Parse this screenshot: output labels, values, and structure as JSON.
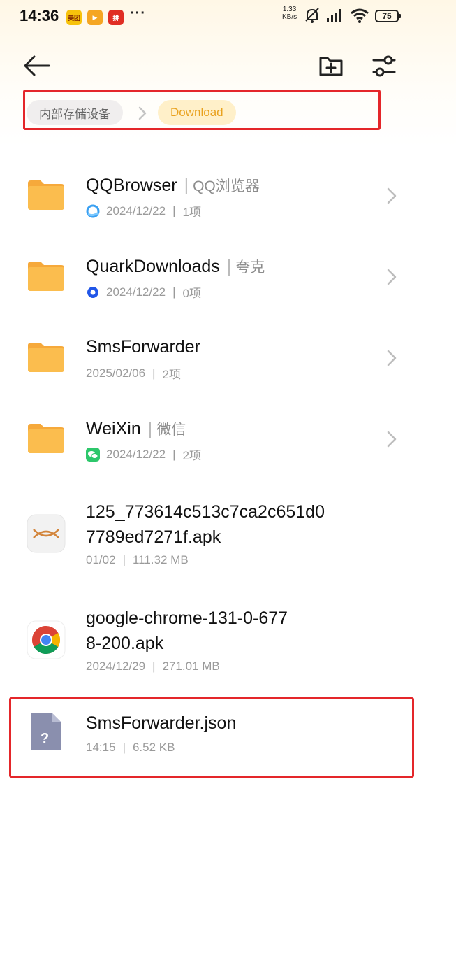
{
  "status_bar": {
    "time": "14:36",
    "app_icons": [
      {
        "name": "meituan",
        "label": "美团",
        "color": "#f7c20b"
      },
      {
        "name": "video-app",
        "label": "▶",
        "color": "#f5a623"
      },
      {
        "name": "pdd",
        "label": "拼",
        "color": "#e02e24"
      }
    ],
    "more": "···",
    "net_speed_value": "1.33",
    "net_speed_unit": "KB/s",
    "battery": "75"
  },
  "toolbar": {
    "back_icon": "arrow-left-icon",
    "new_folder_icon": "folder-plus-icon",
    "filter_icon": "sliders-icon"
  },
  "breadcrumb": {
    "root": "内部存储设备",
    "current": "Download"
  },
  "files": [
    {
      "name": "QQBrowser",
      "alias": "QQ浏览器",
      "date": "2024/12/22",
      "count": "1项",
      "type": "folder",
      "source_icon": "qq-browser-icon"
    },
    {
      "name": "QuarkDownloads",
      "alias": "夸克",
      "date": "2024/12/22",
      "count": "0项",
      "type": "folder",
      "source_icon": "quark-icon"
    },
    {
      "name": "SmsForwarder",
      "date": "2025/02/06",
      "count": "2项",
      "type": "folder"
    },
    {
      "name": "WeiXin",
      "alias": "微信",
      "date": "2024/12/22",
      "count": "2项",
      "type": "folder",
      "source_icon": "wechat-icon"
    },
    {
      "name_line1": "125_773614c513c7ca2c651d0",
      "name_line2": "7789ed7271f.apk",
      "date": "01/02",
      "size": "111.32 MB",
      "type": "apk"
    },
    {
      "name_line1": "google-chrome-131-0-677",
      "name_line2": "8-200.apk",
      "date": "2024/12/29",
      "size": "271.01 MB",
      "type": "apk"
    },
    {
      "name": "SmsForwarder.json",
      "date": "14:15",
      "size": "6.52 KB",
      "type": "unknown",
      "icon_glyph": "?"
    }
  ],
  "colors": {
    "folder": "#fbbd4e",
    "folder_tab": "#f6a93b",
    "highlight": "#e4262a",
    "breadcrumb_current": "#e9a21f",
    "unknown_file": "#8a8fae"
  }
}
